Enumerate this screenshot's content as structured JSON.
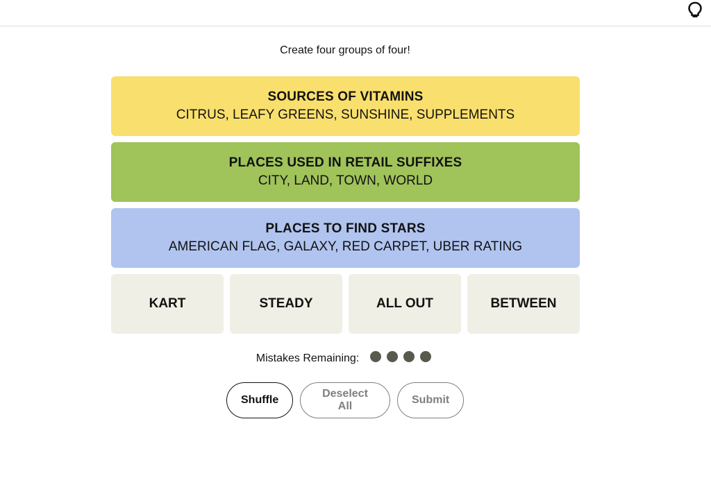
{
  "header": {
    "hint_icon": "lightbulb-icon"
  },
  "instruction": "Create four groups of four!",
  "solved_groups": [
    {
      "title": "SOURCES OF VITAMINS",
      "members": "CITRUS, LEAFY GREENS, SUNSHINE, SUPPLEMENTS",
      "color": "#f9df6d"
    },
    {
      "title": "PLACES USED IN RETAIL SUFFIXES",
      "members": "CITY, LAND, TOWN, WORLD",
      "color": "#a0c35a"
    },
    {
      "title": "PLACES TO FIND STARS",
      "members": "AMERICAN FLAG, GALAXY, RED CARPET, UBER RATING",
      "color": "#b0c4ef"
    }
  ],
  "tiles": [
    "KART",
    "STEADY",
    "ALL OUT",
    "BETWEEN"
  ],
  "tile_color": "#efefe6",
  "mistakes": {
    "label": "Mistakes Remaining:",
    "remaining": 4,
    "dot_color": "#5a594e"
  },
  "buttons": {
    "shuffle": "Shuffle",
    "deselect_all": "Deselect All",
    "submit": "Submit"
  }
}
